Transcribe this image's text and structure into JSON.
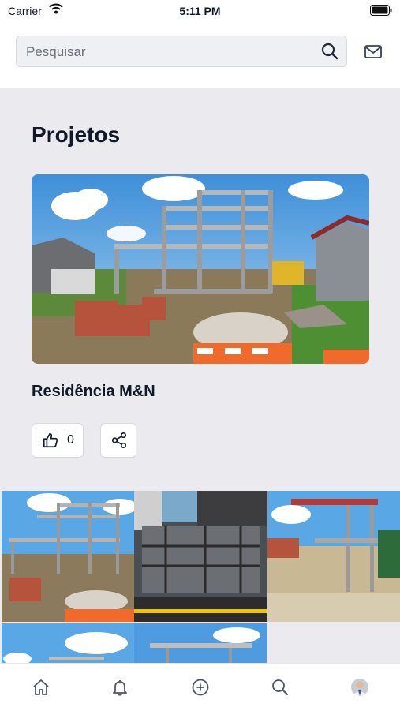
{
  "status_bar": {
    "carrier": "Carrier",
    "time": "5:11 PM"
  },
  "search": {
    "placeholder": "Pesquisar",
    "value": ""
  },
  "page": {
    "title": "Projetos"
  },
  "project": {
    "name": "Residência M&N",
    "likes": "0"
  },
  "icons": {
    "search": "search-icon",
    "mail": "mail-icon",
    "like": "thumbs-up-icon",
    "share": "share-icon",
    "tabs": [
      "home-icon",
      "bell-icon",
      "plus-circle-icon",
      "search-icon",
      "avatar"
    ]
  },
  "colors": {
    "content_bg": "#ebebef",
    "text": "#111827",
    "sky": "#5aa7e6"
  }
}
